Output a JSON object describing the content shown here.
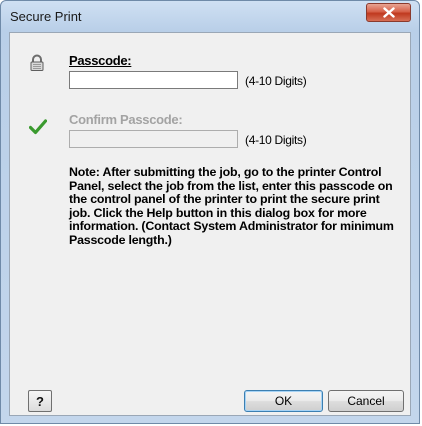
{
  "window": {
    "title": "Secure Print"
  },
  "icons": {
    "close": "close-icon",
    "lock": "lock-icon",
    "check": "checkmark-icon"
  },
  "colors": {
    "close_button": "#c7432b",
    "checkmark": "#3a9a2e",
    "disabled_text": "#a3a3a3"
  },
  "passcode": {
    "label": "Passcode:",
    "value": "",
    "hint": "(4-10 Digits)"
  },
  "confirm": {
    "label": "Confirm Passcode:",
    "value": "",
    "hint": "(4-10 Digits)"
  },
  "note": "Note: After submitting the job, go to the printer Control Panel, select the job from the list, enter this passcode on the control panel of the printer to print the secure print job. Click the Help button in this dialog box for more information. (Contact System Administrator for minimum Passcode length.)",
  "buttons": {
    "help": "?",
    "ok": "OK",
    "cancel": "Cancel"
  }
}
